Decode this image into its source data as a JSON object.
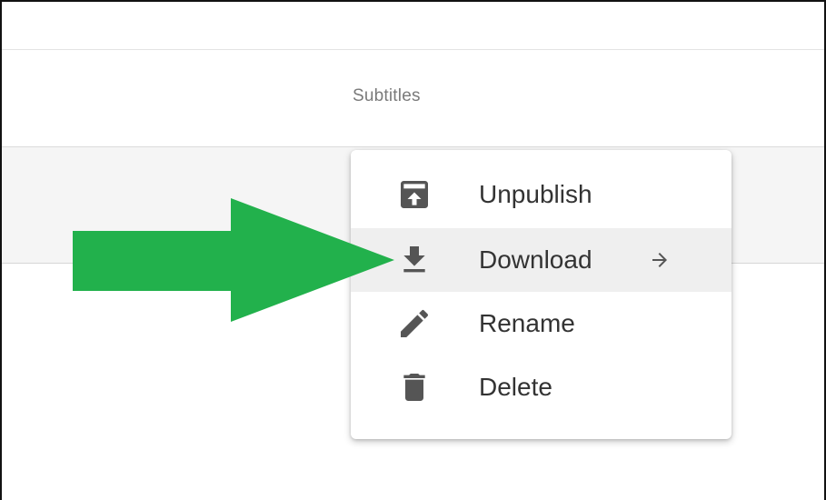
{
  "table": {
    "column_header": "Subtitles"
  },
  "context_menu": {
    "items": [
      {
        "label": "Unpublish",
        "icon": "unpublish-icon",
        "active": false,
        "has_submenu": false
      },
      {
        "label": "Download",
        "icon": "download-icon",
        "active": true,
        "has_submenu": true,
        "submenu_icon": "arrow-right-icon"
      },
      {
        "label": "Rename",
        "icon": "pencil-icon",
        "active": false,
        "has_submenu": false
      },
      {
        "label": "Delete",
        "icon": "trash-icon",
        "active": false,
        "has_submenu": false
      }
    ]
  },
  "annotation": {
    "icon": "green-arrow-icon",
    "color": "#22b14c"
  },
  "colors": {
    "menu_text": "#333333",
    "icon": "#555555",
    "hover_background": "#efefef",
    "row_background": "#f5f5f5",
    "header_text": "#7a7a7a"
  }
}
